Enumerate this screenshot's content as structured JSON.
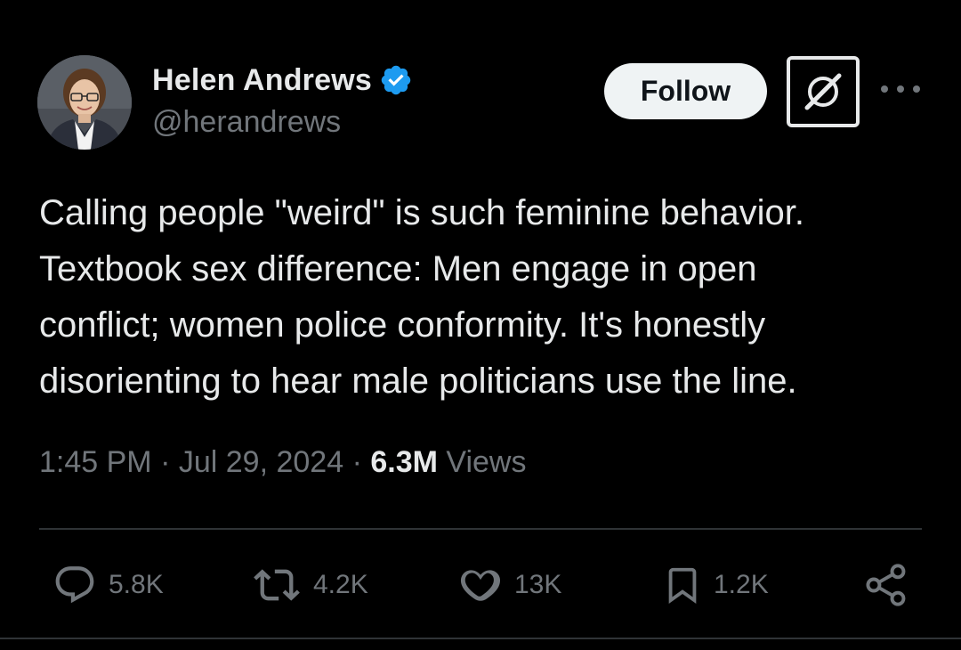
{
  "author": {
    "name": "Helen Andrews",
    "handle": "@herandrews",
    "verified": true
  },
  "header": {
    "follow_label": "Follow",
    "grok_icon": "grok-icon",
    "more_icon": "more-icon"
  },
  "tweet": {
    "lines": [
      "Calling people \"weird\" is such feminine behavior.",
      "Textbook sex difference: Men engage in open",
      "conflict; women police conformity. It's honestly",
      "disorienting to hear male politicians use the line."
    ],
    "time": "1:45 PM",
    "separator": "·",
    "date": "Jul 29, 2024",
    "views_count": "6.3M",
    "views_label": "Views"
  },
  "actions": {
    "replies": "5.8K",
    "reposts": "4.2K",
    "likes": "13K",
    "bookmarks": "1.2K"
  },
  "colors": {
    "background": "#000000",
    "text": "#e7e9ea",
    "muted": "#71767b",
    "verified": "#1d9bf0",
    "divider": "#2f3336"
  }
}
